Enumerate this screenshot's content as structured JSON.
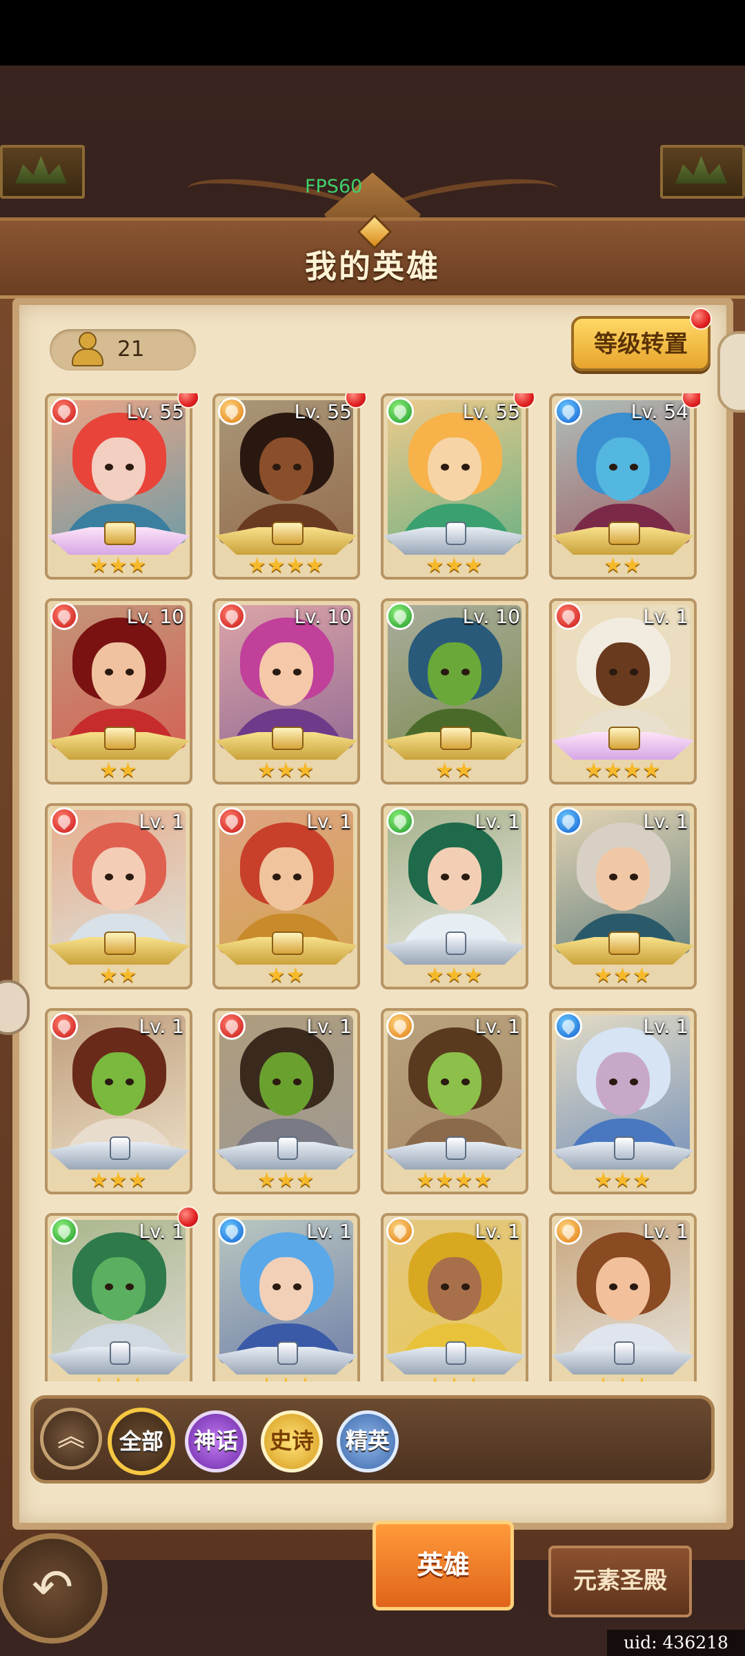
{
  "fps_label": "FPS60",
  "title": "我的英雄",
  "hero_count": "21",
  "reset_button": "等级转置",
  "heroes": [
    {
      "lv": "Lv. 55",
      "element": "fire",
      "stars": "★★★",
      "tier": "pink",
      "dot": true,
      "hair": "#e8443a",
      "face": "#f2cfc0",
      "body": "#3b7fa0"
    },
    {
      "lv": "Lv. 55",
      "element": "light",
      "stars": "★★★★",
      "tier": "gold",
      "dot": true,
      "hair": "#2a1810",
      "face": "#8a4f2a",
      "body": "#6a3a20"
    },
    {
      "lv": "Lv. 55",
      "element": "nature",
      "stars": "★★★",
      "tier": "grey",
      "dot": true,
      "hair": "#f7b24a",
      "face": "#f6d4a6",
      "body": "#3aa070"
    },
    {
      "lv": "Lv. 54",
      "element": "water",
      "stars": "★★",
      "tier": "gold",
      "dot": true,
      "hair": "#3a8fd0",
      "face": "#53b7e0",
      "body": "#7a2a48"
    },
    {
      "lv": "Lv. 10",
      "element": "fire",
      "stars": "★★",
      "tier": "gold",
      "dot": false,
      "hair": "#7a1212",
      "face": "#f0c2a0",
      "body": "#c72c2c"
    },
    {
      "lv": "Lv. 10",
      "element": "fire",
      "stars": "★★★",
      "tier": "gold",
      "dot": false,
      "hair": "#c0409a",
      "face": "#f4c8a8",
      "body": "#6e3a8a"
    },
    {
      "lv": "Lv. 10",
      "element": "nature",
      "stars": "★★",
      "tier": "gold",
      "dot": false,
      "hair": "#2a5a7a",
      "face": "#6aa83a",
      "body": "#4a6a2a"
    },
    {
      "lv": "Lv. 1",
      "element": "fire",
      "stars": "★★★★",
      "tier": "pink",
      "dot": false,
      "hair": "#f2ece0",
      "face": "#6a3a1e",
      "body": "#e8e0cc"
    },
    {
      "lv": "Lv. 1",
      "element": "fire",
      "stars": "★★",
      "tier": "gold",
      "dot": false,
      "hair": "#e06050",
      "face": "#f4cdb6",
      "body": "#d8e0e8"
    },
    {
      "lv": "Lv. 1",
      "element": "fire",
      "stars": "★★",
      "tier": "gold",
      "dot": false,
      "hair": "#c8402a",
      "face": "#f0c49c",
      "body": "#c88a2a"
    },
    {
      "lv": "Lv. 1",
      "element": "nature",
      "stars": "★★★",
      "tier": "grey",
      "dot": false,
      "hair": "#1e6a4a",
      "face": "#f2cfb4",
      "body": "#e6eef4"
    },
    {
      "lv": "Lv. 1",
      "element": "water",
      "stars": "★★★",
      "tier": "gold",
      "dot": false,
      "hair": "#d8d0c4",
      "face": "#f0c8a6",
      "body": "#2a5a6a"
    },
    {
      "lv": "Lv. 1",
      "element": "fire",
      "stars": "★★★",
      "tier": "grey",
      "dot": false,
      "hair": "#6a2a1a",
      "face": "#7ab83e",
      "body": "#e8dccc"
    },
    {
      "lv": "Lv. 1",
      "element": "fire",
      "stars": "★★★",
      "tier": "grey",
      "dot": false,
      "hair": "#3a2a1e",
      "face": "#6aa02e",
      "body": "#7a7a84"
    },
    {
      "lv": "Lv. 1",
      "element": "light",
      "stars": "★★★★",
      "tier": "grey",
      "dot": false,
      "hair": "#5a3a1e",
      "face": "#8cc04a",
      "body": "#8a6a4a"
    },
    {
      "lv": "Lv. 1",
      "element": "water",
      "stars": "★★★",
      "tier": "grey",
      "dot": false,
      "hair": "#d6e4f4",
      "face": "#c8a8c8",
      "body": "#4a78c0"
    },
    {
      "lv": "Lv. 1",
      "element": "nature",
      "stars": "★★★",
      "tier": "grey",
      "dot": true,
      "hair": "#2e7a4a",
      "face": "#5ab060",
      "body": "#d0d8e0"
    },
    {
      "lv": "Lv. 1",
      "element": "water",
      "stars": "★★★",
      "tier": "grey",
      "dot": false,
      "hair": "#5aa8e8",
      "face": "#f2d0b8",
      "body": "#3a5aa8"
    },
    {
      "lv": "Lv. 1",
      "element": "light",
      "stars": "★★★",
      "tier": "grey",
      "dot": false,
      "hair": "#d8a820",
      "face": "#a8704a",
      "body": "#e8c23a"
    },
    {
      "lv": "Lv. 1",
      "element": "light",
      "stars": "★★★",
      "tier": "grey",
      "dot": false,
      "hair": "#8a4a22",
      "face": "#f2c09a",
      "body": "#e0e4ec"
    }
  ],
  "filters": {
    "all": "全部",
    "myth": "神话",
    "epic": "史诗",
    "elite": "精英"
  },
  "tabs": {
    "hero": "英雄",
    "shrine": "元素圣殿"
  },
  "uid": "uid: 436218",
  "colors": {
    "frame_brown": "#6b3e22",
    "panel_cream": "#f1e2c4",
    "accent_gold": "#f6c842",
    "active_tab_orange": "#e0641a"
  }
}
